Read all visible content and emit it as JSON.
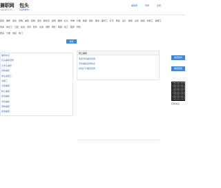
{
  "header": {
    "logo": "兼职网",
    "logo_sub": "jianzhi.com",
    "city": "包头",
    "city_switch": "[切换城市]",
    "top_links": [
      "兼职网",
      "登录",
      "注册"
    ]
  },
  "categories": {
    "row1": [
      "首页",
      "推荐",
      "送货",
      "家教",
      "兼职",
      "促销",
      "话务",
      "服务员",
      "模特",
      "翻译",
      "礼仪",
      "传单",
      "分拣",
      "收银",
      "摄影",
      "保洁",
      "临时工",
      "打字",
      "网店",
      "设计",
      "编辑",
      "主持",
      "校园",
      "寒假工",
      "暑假工"
    ],
    "row2": [
      "周末",
      "钟点工",
      "日结",
      "在线",
      "手机",
      "软件",
      "文案",
      "调研",
      "销售",
      "客服",
      "技工",
      "装卸",
      "司机"
    ],
    "row3": [
      "更多",
      "分类",
      "地区",
      "热门"
    ]
  },
  "search": {
    "button": "搜索"
  },
  "left_list": [
    "兼职信息",
    "包头兼职招聘",
    "大学生兼职",
    "周末兼职",
    "学生暑假工",
    "寒假工",
    "日结兼职",
    "网上兼职",
    "在线兼职",
    "手机兼职",
    "家教兼职",
    "促销兼职"
  ],
  "mid_panel": {
    "title": "网上兼职",
    "items": [
      "免费手机兼职招聘",
      "手机兼职招聘信息",
      "在线打字兼职招聘"
    ]
  },
  "right_panel": {
    "button1": "免费发布",
    "button2": "兼职招聘",
    "qr_caption": "扫码关注"
  }
}
